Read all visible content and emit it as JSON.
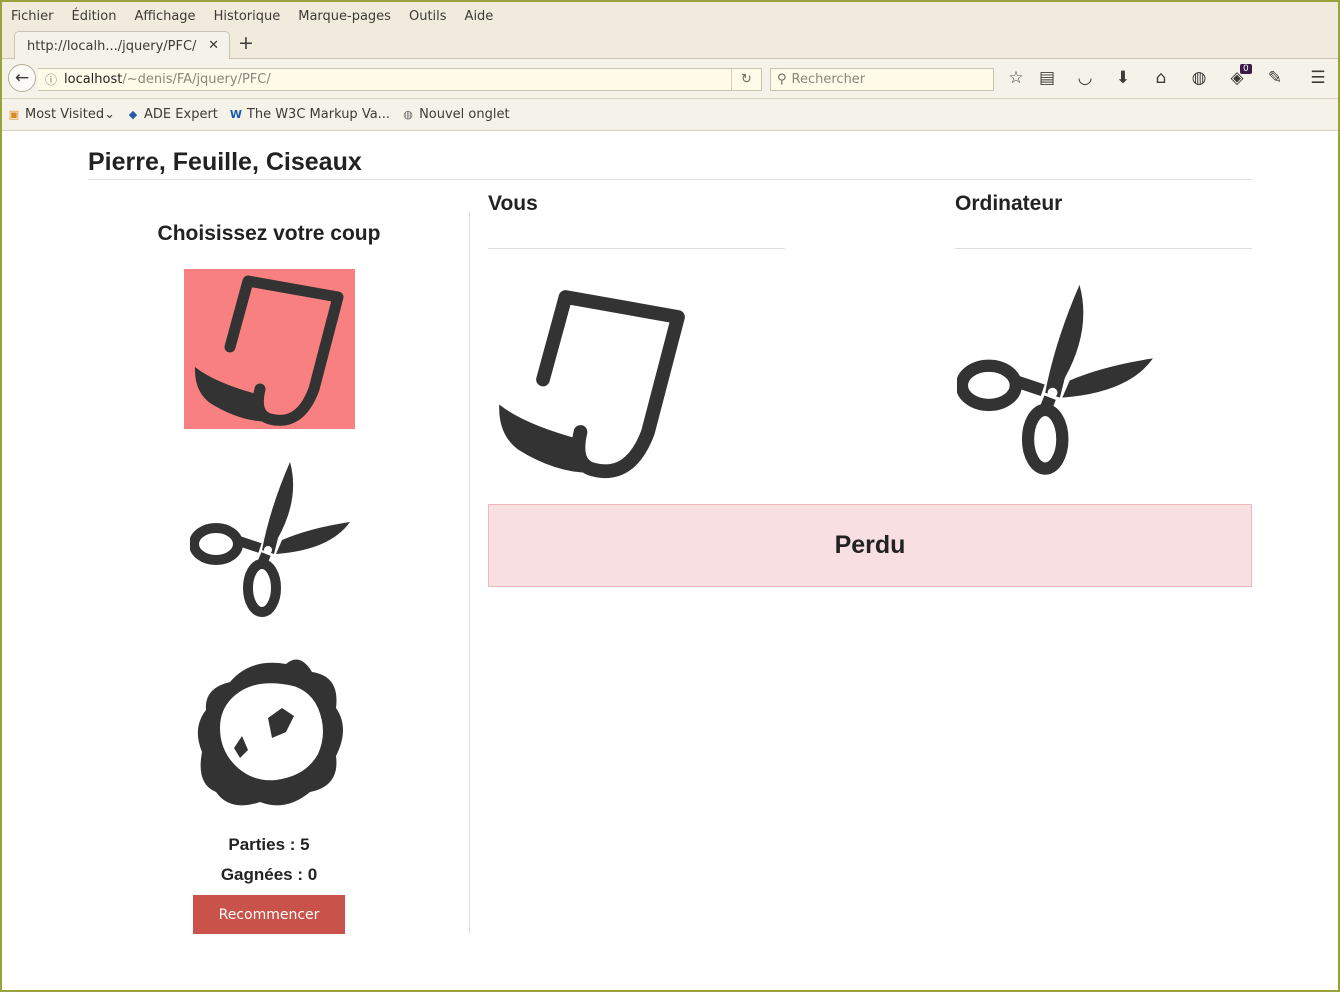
{
  "browser": {
    "menu": [
      "Fichier",
      "Édition",
      "Affichage",
      "Historique",
      "Marque-pages",
      "Outils",
      "Aide"
    ],
    "tab_title": "http://localh.../jquery/PFC/",
    "url_host": "localhost",
    "url_path": "/~denis/FA/jquery/PFC/",
    "search_placeholder": "Rechercher",
    "notification_count": "0",
    "bookmarks": [
      "Most Visited",
      "ADE Expert",
      "The W3C Markup Va...",
      "Nouvel onglet"
    ]
  },
  "page": {
    "title": "Pierre, Feuille, Ciseaux",
    "choose_label": "Choisissez votre coup",
    "choices": [
      "paper",
      "scissors",
      "rock"
    ],
    "selected_choice": "paper",
    "games_label": "Parties : 5",
    "wins_label": "Gagnées : 0",
    "restart_label": "Recommencer",
    "player_label": "Vous",
    "player_move": "paper",
    "computer_label": "Ordinateur",
    "computer_move": "scissors",
    "result_label": "Perdu"
  },
  "colors": {
    "selected_bg": "#f98080",
    "restart_bg": "#c9524a",
    "result_bg": "#f8dfe1",
    "icon": "#333333"
  }
}
